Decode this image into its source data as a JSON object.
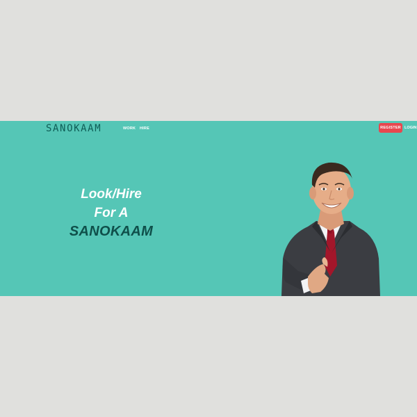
{
  "header": {
    "logo": "SANOKAAM",
    "nav": {
      "work": "WORK",
      "hire": "HIRE"
    },
    "register_label": "REGISTER",
    "login_label": "LOGIN"
  },
  "hero": {
    "line1": "Look/Hire",
    "line2": "For A",
    "line3": "SANOKAAM"
  },
  "colors": {
    "banner_bg": "#55c6b6",
    "page_bg": "#e0e0dd",
    "logo": "#0f5d56",
    "register_bg": "#e8474f",
    "brand_text": "#0f4f4a"
  }
}
